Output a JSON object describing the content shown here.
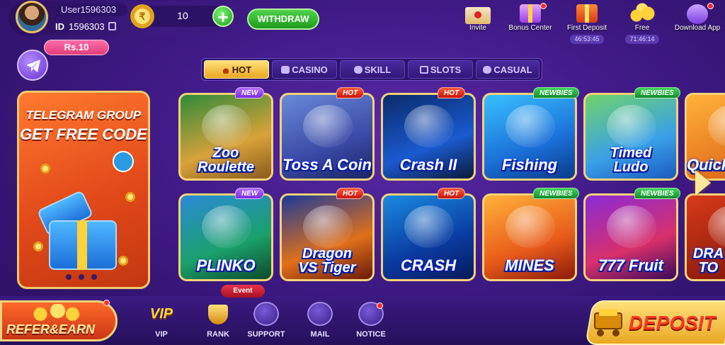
{
  "profile": {
    "username": "User1596303",
    "id_label": "ID",
    "id_value": "1596303",
    "balance": "10",
    "withdraw_label": "WITHDRAW"
  },
  "top_icons": [
    {
      "label": "Invite",
      "icon": "invite-icon"
    },
    {
      "label": "Bonus Center",
      "icon": "bonus-center-icon"
    },
    {
      "label": "First Deposit",
      "icon": "first-deposit-icon",
      "timer": "46:53:45"
    },
    {
      "label": "Free",
      "icon": "free-coins-icon",
      "timer": "71:46:14"
    },
    {
      "label": "Download App",
      "icon": "download-app-icon"
    }
  ],
  "rs_bubble": "Rs.10",
  "tabs": [
    {
      "label": "HOT",
      "active": true
    },
    {
      "label": "CASINO"
    },
    {
      "label": "SKILL"
    },
    {
      "label": "SLOTS"
    },
    {
      "label": "CASUAL"
    }
  ],
  "banner": {
    "line1": "TELEGRAM GROUP",
    "line2": "GET FREE CODE"
  },
  "games": [
    {
      "title_lines": [
        "Zoo",
        "Roulette"
      ],
      "badge": "NEW"
    },
    {
      "title_lines": [
        "Toss A Coin"
      ],
      "badge": "HOT"
    },
    {
      "title_lines": [
        "Crash II"
      ],
      "badge": "HOT"
    },
    {
      "title_lines": [
        "Fishing"
      ],
      "badge": "NEWBIES"
    },
    {
      "title_lines": [
        "Timed",
        "Ludo"
      ],
      "badge": "NEWBIES"
    },
    {
      "title_lines": [
        "Quick"
      ],
      "badge": ""
    },
    {
      "title_lines": [
        "PLINKO"
      ],
      "badge": "NEW"
    },
    {
      "title_lines": [
        "Dragon",
        "VS Tiger"
      ],
      "badge": "HOT"
    },
    {
      "title_lines": [
        "CRASH"
      ],
      "badge": "HOT"
    },
    {
      "title_lines": [
        "MINES"
      ],
      "badge": "NEWBIES"
    },
    {
      "title_lines": [
        "777 Fruit"
      ],
      "badge": "NEWBIES"
    },
    {
      "title_lines": [
        "DRA",
        "TO"
      ],
      "badge": ""
    }
  ],
  "bottom": {
    "refer_label": "REFER&EARN",
    "nav": [
      {
        "label": "VIP"
      },
      {
        "label": "RANK"
      },
      {
        "label": "SUPPORT"
      },
      {
        "label": "MAIL"
      },
      {
        "label": "NOTICE"
      }
    ],
    "event_tag": "Event",
    "deposit_label": "DEPOSIT"
  },
  "colors": {
    "background": "#3f1a86",
    "gold": "#f3d27a",
    "badge_new": "#7a2be0",
    "badge_hot": "#c8140b",
    "badge_newbies": "#128a2b",
    "withdraw": "#1f9a1c"
  }
}
